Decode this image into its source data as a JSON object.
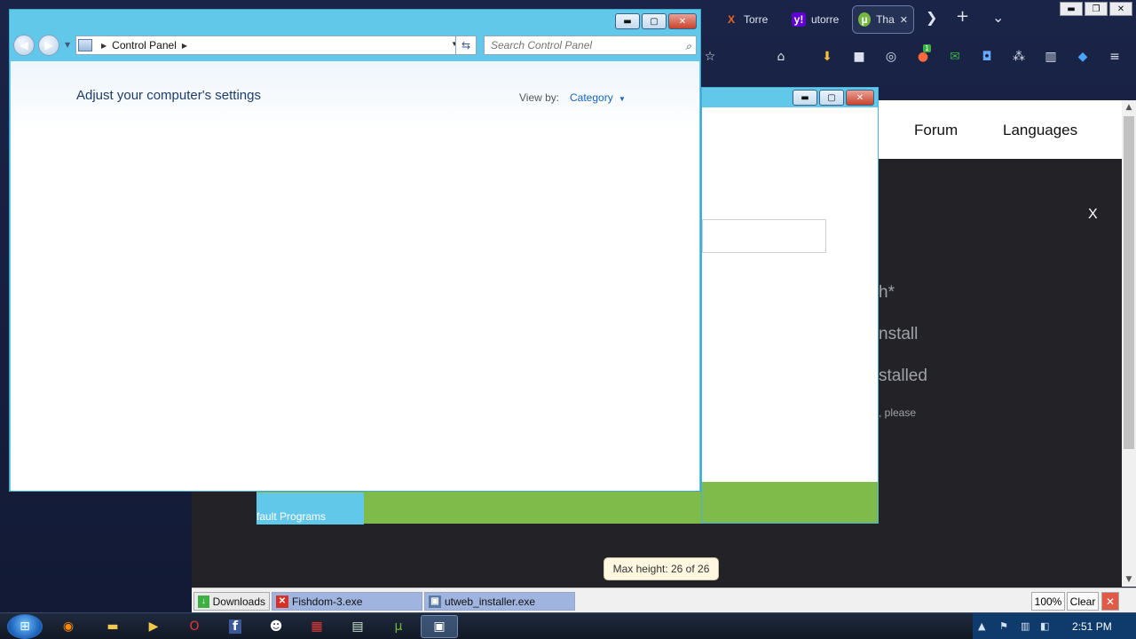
{
  "browser": {
    "tabs": [
      {
        "label": "Torre",
        "icon": "torrent-x-icon",
        "icon_glyph": "X",
        "icon_color": "#f26522"
      },
      {
        "label": "utorre",
        "icon": "yahoo-icon",
        "icon_glyph": "y!",
        "icon_color": "#6001d2"
      },
      {
        "label": "Tha",
        "icon": "utorrent-icon",
        "icon_glyph": "µ",
        "icon_color": "#76b83f"
      }
    ],
    "tab_close_glyph": "✕",
    "tab_forward_glyph": "❯",
    "new_tab_glyph": "+",
    "tab_list_glyph": "⌄",
    "window_glyphs": {
      "minimize": "▬",
      "restore": "❐",
      "close": "✕"
    },
    "toolbar_badge": "1",
    "page": {
      "nav": [
        "Forum",
        "Languages"
      ],
      "close_label": "X",
      "fragments": [
        "h*",
        "nstall",
        "stalled",
        ", please"
      ]
    },
    "downloads": {
      "items": [
        "Downloads",
        "Fishdom-3.exe",
        "utweb_installer.exe"
      ],
      "zoom": "100%",
      "clear": "Clear"
    },
    "tooltip": "Max height: 26 of 26"
  },
  "window2": {
    "tile_label": "fault Programs"
  },
  "control_panel": {
    "breadcrumb": "Control Panel",
    "search_placeholder": "Search Control Panel",
    "title": "Adjust your computer's settings",
    "view_by_label": "View by:",
    "view_by_value": "Category",
    "window_glyphs": {
      "minimize": "▬",
      "maximize": "▢",
      "close": "✕"
    }
  },
  "taskbar": {
    "clock": "2:51 PM"
  },
  "colors": {
    "window_frame": "#62c8ea",
    "accent_green": "#7fbb4a",
    "link_blue": "#1565c0",
    "title_blue": "#1e3d6b"
  }
}
